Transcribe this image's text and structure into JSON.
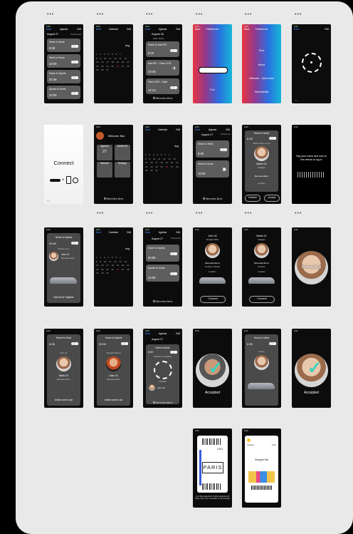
{
  "row1": {
    "s1": {
      "date": "August 27",
      "prefs": "Preferences",
      "cards": [
        {
          "title": "Home to Work",
          "time": "8:35"
        },
        {
          "title": "Work to Home",
          "time": "18:00"
        },
        {
          "title": "Home to Sports",
          "time": "20:45"
        },
        {
          "title": "Sports to Home",
          "time": "22:00"
        }
      ]
    },
    "s2": {
      "month": "Aug"
    },
    "s3": {
      "date": "August 30",
      "route": "Arta - Paris",
      "cards": [
        {
          "title": "Home to Arta EFL",
          "time": "6:15"
        },
        {
          "title": "Arta EFL - Paris CDG",
          "time": "10:40"
        },
        {
          "title": "Paris CDG - Hotel",
          "time": "12:1A"
        }
      ],
      "brand": "Mercedes-Benz"
    },
    "s4": {
      "title": "Preferences",
      "label": "Fun"
    },
    "s5": {
      "title": "Preferences",
      "items": [
        "Time",
        "Mood",
        "Network - Openness",
        "Shareability"
      ]
    },
    "s6": {}
  },
  "row2": {
    "s1": {
      "title": "Connect"
    },
    "s2": {
      "greeting": "Welcome, Bas",
      "tiles": [
        "Agenda",
        "Mobile Kit",
        "Network",
        "Settings"
      ],
      "agenda_num": "27",
      "brand": "Mercedes-Benz"
    },
    "s3": {
      "month": "Aug"
    },
    "s4": {
      "date": "August 27",
      "prefs": "Preferences",
      "cards": [
        {
          "title": "Home to Work",
          "time": "8:35"
        },
        {
          "title": "Work to Home",
          "time": "18:00"
        }
      ],
      "brand": "Mercedes-Benz"
    },
    "s5": {
      "heading": "Home to Work",
      "time": "8:35",
      "sub": "Martin wants to join",
      "name": "Martin 22",
      "city": "Stuttgart",
      "car": "Mercedes-Benz",
      "loc": "Location",
      "decline": "Decline",
      "accept": "Accept"
    },
    "s6": {
      "prompt": "Say your name and look to the device to log in"
    }
  },
  "row3": {
    "s1": {
      "heading": "Home to Sports",
      "time": "20:00",
      "sub": "Picked up by",
      "name": "John 24",
      "car": "Mercedes-Benz",
      "footer": "Click Drive Together"
    },
    "s2": {
      "month": "Aug"
    },
    "s3": {
      "date": "August 27",
      "prefs": "Preferences",
      "cards": [
        {
          "title": "Home to Sports",
          "time": "20:50"
        },
        {
          "title": "Sports to Home",
          "time": "22:00"
        }
      ],
      "brand": "Mercedes-Benz"
    },
    "s4": {
      "name": "John 24",
      "city": "Stuttgart Mitte",
      "car": "Mercedes-Benz",
      "model": "E-Class T-Model",
      "loc": "Location",
      "btn": "Connect"
    },
    "s5": {
      "name": "Martin 22",
      "city": "Stuttgart",
      "car": "Mercedes-Benz",
      "model": "E-Class",
      "loc": "Location",
      "btn": "Connect"
    },
    "s6": {
      "label": "Connecting"
    }
  },
  "row4": {
    "s1": {
      "heading": "Home to Work",
      "time": "8:35",
      "sub": "Pick Up",
      "name": "Martin 22",
      "car": "Mercedes-Benz",
      "footer": "Advice sent to car"
    },
    "s2": {
      "heading": "Home to Sports",
      "time": "20:00",
      "sub": "Network Shared",
      "name": "Daan 24",
      "car": "Mercedes-Benz",
      "footer": "Advice sent to car"
    },
    "s3": {
      "date": "August 27",
      "heading": "Home to Work",
      "time": "8:30",
      "sub": "Network not available",
      "avail": "Available",
      "name": "John 24",
      "brand": "Mercedes-Benz"
    },
    "s4": {
      "label": "Accepted"
    },
    "s5": {
      "heading": "Home to Work",
      "time": "8:35",
      "sub": "driving"
    },
    "s6": {
      "label": "Accepted"
    }
  },
  "row5": {
    "t1": {
      "code": "CDG",
      "city": "PARIS",
      "caption": "Your Mercedes-Benz will be cleaned and taken care of by a carwash in the meaning"
    },
    "t2": {
      "from": "Stuttgart",
      "to": "Stuttgart Hbf",
      "time": "12:30"
    }
  }
}
